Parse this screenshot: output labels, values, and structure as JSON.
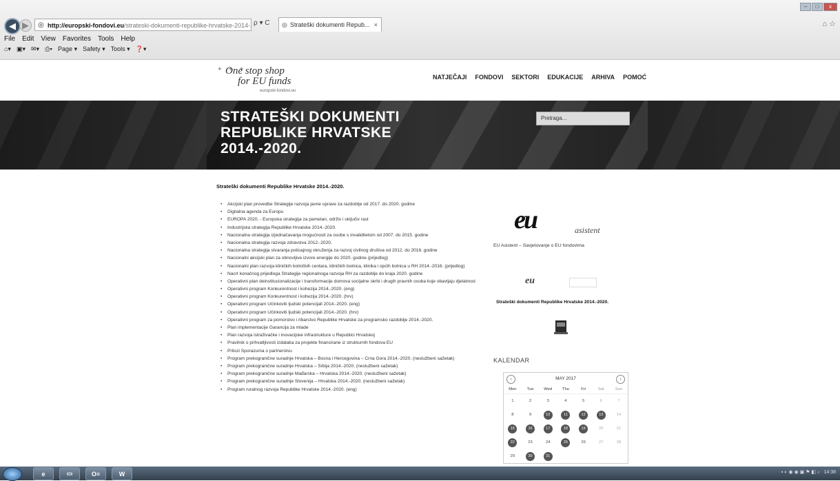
{
  "browser": {
    "url_domain": "http://europski-fondovi.eu",
    "url_path": "/strateski-dokumenti-republike-hrvatske-2014-2020",
    "addr_controls": "ρ ▾ C",
    "tab_title": "Strateški dokumenti Repub...",
    "menu": [
      "File",
      "Edit",
      "View",
      "Favorites",
      "Tools",
      "Help"
    ],
    "commands": [
      "Page ▾",
      "Safety ▾",
      "Tools ▾"
    ]
  },
  "logo": {
    "line1": "One stop shop",
    "line2": "for EU funds",
    "line3": "europski-fondovi.eu"
  },
  "nav": [
    "NATJEČAJI",
    "FONDOVI",
    "SEKTORI",
    "EDUKACIJE",
    "ARHIVA",
    "POMOĆ"
  ],
  "banner": {
    "line1": "STRATEŠKI DOKUMENTI",
    "line2": "REPUBLIKE HRVATSKE",
    "line3": "2014.-2020.",
    "search_placeholder": "Pretraga..."
  },
  "content": {
    "title": "Strateški dokumenti Republike Hrvatske 2014.-2020.",
    "items": [
      "Akcijski plan provedbe Strategije razvoja javne uprave za razdoblje od 2017. do 2020. godine",
      "Digitalna agenda za Europu",
      "EUROPA 2020. - Europska strategija za pametan, održiv i uključiv rast",
      "Industrijska strategija Republike Hrvatske 2014.-2020.",
      "Nacionalna strategija izjednačavanja mogućnosti za osobe s invaliditetom od 2007. do 2015. godine",
      "Nacionalna strategija razvoja zdravstva 2012.-2020.",
      "Nacionalna strategija stvaranja poticajnog okruženja za razvoj civilnog društva od 2012. do 2016. godine",
      "Nacionalni akcijski plan za obnovljive izvore energije do 2020. godine (prijedlog)",
      "Nacionalni plan razvoja kliničkih bolničkih centara, kliničkih bolnica, klinika i općih bolnica u RH 2014.-2016. (prijedlog)",
      "Nacrt konačnog prijedloga Strategije regionalnoga razvoja RH za razdoblje do kraja 2020. godine",
      "Operativni plan deinstitucionalizacije i transformacije domova socijalne skrbi i drugih pravnih osoba koje obavljaju djelatnost",
      "Operativni program Konkurentnost i kohezija 2014.-2020. (eng)",
      "Operativni program Konkurentnost i kohezija 2014.-2020. (hrv)",
      "Operativni program Učinkoviti ljudski potencijali 2014.-2020. (eng)",
      "Operativni program Učinkoviti ljudski potencijali 2014.-2020. (hrv)",
      "Operativni program za pomorstvo i ribarstvo Republike Hrvatske za programsko razdoblje 2014.-2020.",
      "Plan implementacije Garancija za mlade",
      "Plan razvoja istraživačke i inovacijske infrastrukture u Republici Hrvatskoj",
      "Pravilnik o prihvatljivosti izdataka za projekte financirane iz strukturnih fondova EU",
      "Prilozi Sporazuma o partnerstvu",
      "Program prekogranične suradnje Hrvatska – Bosna i Hercegovina – Crna Gora 2014.-2020. (neslužbeni sažetak)",
      "Program prekogranične suradnje Hrvatska – Srbija 2014.-2020. (neslužbeni sažetak)",
      "Program prekogranične suradnje Mađarska – Hrvatska 2014.-2020. (neslužbeni sažetak)",
      "Program prekogranične suradnje Slovenija – Hrvatska 2014.-2020. (neslužbeni sažetak)",
      "Program ruralnog razvoja Republike Hrvatske 2014.-2020. (eng)"
    ]
  },
  "sidebar": {
    "eu_logo_big": "eu",
    "eu_logo_small": "asistent",
    "eu_caption": "EU Asistent – Savjetovanje o EU fondovima",
    "thumb_text": "eu",
    "doc_title": "Strateški dokumenti Republike Hrvatske 2014.-2020.",
    "calendar_heading": "KALENDAR",
    "calendar": {
      "month": "MAY 2017",
      "day_names": [
        "Mon",
        "Tue",
        "Wed",
        "Thu",
        "Fri",
        "Sat",
        "Sun"
      ],
      "rows": [
        [
          "1",
          "2",
          "3",
          "4",
          "5",
          "6",
          "7"
        ],
        [
          "8",
          "9",
          "10",
          "11",
          "12",
          "13",
          "14"
        ],
        [
          "15",
          "16",
          "17",
          "18",
          "19",
          "20",
          "21"
        ],
        [
          "22",
          "23",
          "24",
          "25",
          "26",
          "27",
          "28"
        ],
        [
          "29",
          "30",
          "31",
          "",
          "",
          "",
          ""
        ]
      ],
      "event_days": [
        "10",
        "11",
        "12",
        "13",
        "15",
        "16",
        "17",
        "18",
        "19",
        "22",
        "25",
        "30",
        "31"
      ]
    }
  },
  "taskbar": {
    "apps": [
      "O≡",
      "W"
    ],
    "clock": "14:38"
  }
}
